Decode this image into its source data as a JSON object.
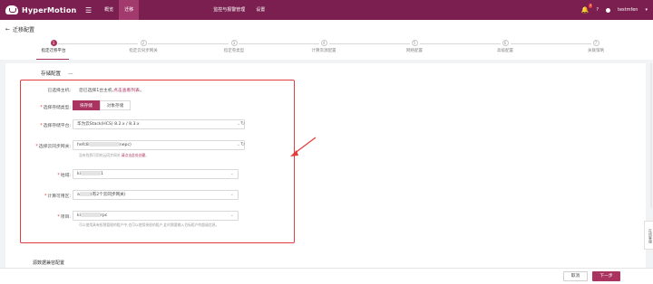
{
  "topbar": {
    "app_name": "HyperMotion",
    "nav": [
      "概览",
      "迁移"
    ],
    "nav_full": [
      {
        "label": "概览",
        "active": false
      },
      {
        "label": "迁移",
        "active": true
      },
      {
        "label": "",
        "active": false
      },
      {
        "label": "",
        "active": false
      },
      {
        "label": "监控与报警管理",
        "active": false
      },
      {
        "label": "设置",
        "active": false
      }
    ],
    "bell_count": "2",
    "user": "testmfen"
  },
  "page": {
    "title": "迁移配置"
  },
  "steps": [
    {
      "num": "1",
      "label": "指定迁移平台",
      "active": true
    },
    {
      "num": "2",
      "label": "指定云同步网关",
      "active": false
    },
    {
      "num": "3",
      "label": "指定卷类型",
      "active": false
    },
    {
      "num": "4",
      "label": "计算资源配置",
      "active": false
    },
    {
      "num": "5",
      "label": "网络配置",
      "active": false
    },
    {
      "num": "6",
      "label": "高级配置",
      "active": false
    },
    {
      "num": "7",
      "label": "关联策略",
      "active": false
    }
  ],
  "form": {
    "section_title": "存储配置",
    "section_dash": "—",
    "chosen_label": "已选择主机:",
    "chosen_text": "您已选择1台主机,",
    "chosen_link": "点击查看列表",
    "chosen_end": "。",
    "storage_type_label": "选择存储类型:",
    "storage_type_options": [
      "块存储",
      "对象存储"
    ],
    "platform_label": "选择存储平台:",
    "platform_value": "华为云Stack(HCS) 8.2.x / 8.3.x",
    "gateway_label": "选择云同步网关:",
    "gateway_value_prefix": "hefc8",
    "gateway_value_suffix": "nepc)",
    "gateway_hint": "没有找到可用的云同步网关,",
    "gateway_hint_link": "请点击此处创建",
    "gateway_hint_end": "。",
    "region_label": "地域:",
    "region_value_prefix": "ki",
    "region_value_suffix": "1",
    "az_label": "计算可用区:",
    "az_value_prefix": "a",
    "az_value_suffix": "(有2个云同步网关)",
    "project_label": "项目:",
    "project_value_prefix": "ki",
    "project_value_suffix": "rpc",
    "project_hint": "可以使用具有权限管理的租户中,也可以使用授权的租户,此时需要输入目标租户的超级信息。"
  },
  "next_section": "源数据兼容配置",
  "footer": {
    "cancel": "取消",
    "next": "下一步"
  },
  "float_panel": "在线客服"
}
